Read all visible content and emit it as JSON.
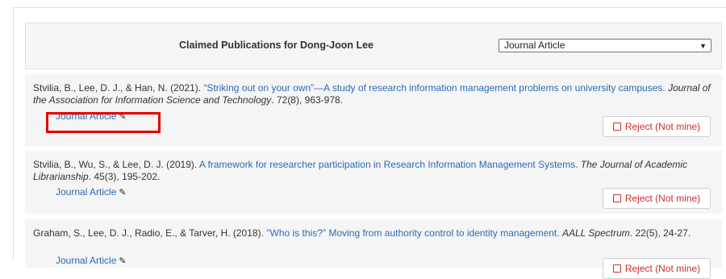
{
  "header": {
    "title": "Claimed Publications for Dong-Joon Lee",
    "filter_value": "Journal Article"
  },
  "publications": [
    {
      "authors": "Stvilia, B., Lee, D. J., & Han, N. (2021).",
      "title": "“Striking out on your own”—A study of research information management problems on university campuses.",
      "journal": "Journal of the Association for Information Science and Technology",
      "details": ". 72(8), 963-978.",
      "type": "Journal Article",
      "reject": "Reject (Not mine)"
    },
    {
      "authors": "Stvilia, B., Wu, S., & Lee, D. J. (2019).",
      "title": "A framework for researcher participation in Research Information Management Systems.",
      "journal": "The Journal of Academic Librarianship",
      "details": ". 45(3), 195-202.",
      "type": "Journal Article",
      "reject": "Reject (Not mine)"
    },
    {
      "authors": "Graham, S., Lee, D. J., Radio, E., & Tarver, H. (2018).",
      "title": "\"Who is this?\" Moving from authority control to identity management.",
      "journal": "AALL Spectrum",
      "details": ". 22(5), 24-27.",
      "type": "Journal Article",
      "reject": "Reject (Not mine)"
    }
  ]
}
